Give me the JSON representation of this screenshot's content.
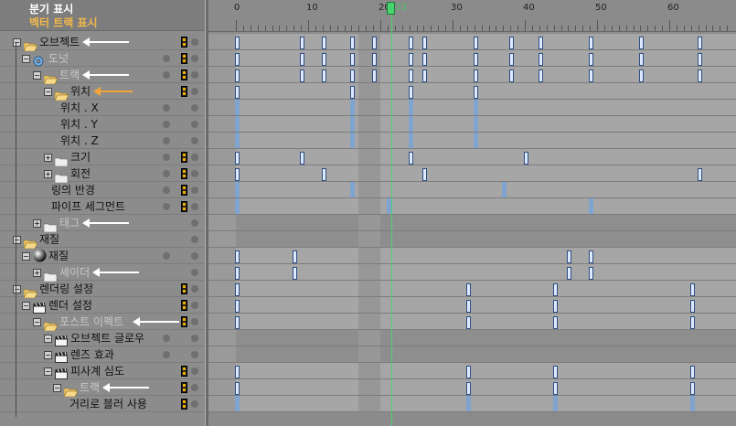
{
  "header": {
    "title": "분기 표시",
    "subtitle": "벡터 트랙 표시"
  },
  "ruler": {
    "labels": [
      "0",
      "10",
      "20",
      "30",
      "40",
      "50",
      "60"
    ],
    "current_frame": "22"
  },
  "tree": [
    {
      "label": "오브젝트",
      "level": 0,
      "icon": "folder-open-icon",
      "arrow": "white"
    },
    {
      "label": "도넛",
      "level": 1,
      "icon": "donut-icon",
      "dim": true
    },
    {
      "label": "트랙",
      "level": 2,
      "icon": "folder-open-icon",
      "dim": true,
      "arrow": "white"
    },
    {
      "label": "위치",
      "level": 3,
      "icon": "folder-open-icon",
      "arrow": "orange"
    },
    {
      "label": "위치 . X",
      "level": 4,
      "icon": "none"
    },
    {
      "label": "위치 . Y",
      "level": 4,
      "icon": "none"
    },
    {
      "label": "위치 . Z",
      "level": 4,
      "icon": "none"
    },
    {
      "label": "크기",
      "level": 3,
      "icon": "folder-closed-icon"
    },
    {
      "label": "회전",
      "level": 3,
      "icon": "folder-closed-icon"
    },
    {
      "label": "링의 반경",
      "level": 3,
      "icon": "none"
    },
    {
      "label": "파이프 세그먼트",
      "level": 3,
      "icon": "none"
    },
    {
      "label": "태그",
      "level": 2,
      "icon": "folder-closed-icon",
      "dim": true,
      "arrow": "white"
    },
    {
      "label": "재질",
      "level": 0,
      "icon": "folder-open-icon"
    },
    {
      "label": "재질",
      "level": 1,
      "icon": "sphere-icon"
    },
    {
      "label": "셰이더",
      "level": 2,
      "icon": "folder-closed-icon",
      "dim": true,
      "arrow": "white"
    },
    {
      "label": "렌더링 설정",
      "level": 0,
      "icon": "folder-open-icon"
    },
    {
      "label": "렌더 설정",
      "level": 1,
      "icon": "render-settings-icon"
    },
    {
      "label": "포스트 이펙트",
      "level": 2,
      "icon": "folder-open-icon",
      "dim": true,
      "arrow": "white"
    },
    {
      "label": "오브젝트 글로우",
      "level": 3,
      "icon": "clapper-icon"
    },
    {
      "label": "렌즈 효과",
      "level": 3,
      "icon": "clapper-icon"
    },
    {
      "label": "피사계 심도",
      "level": 3,
      "icon": "clapper-icon"
    },
    {
      "label": "트랙",
      "level": 4,
      "icon": "folder-open-icon",
      "dim": true,
      "arrow": "white"
    },
    {
      "label": "거리로 블러 사용",
      "level": 5,
      "icon": "none"
    }
  ],
  "tracks": [
    {
      "keys": [
        0,
        9,
        12,
        16,
        19,
        24,
        26,
        33,
        38,
        42,
        49,
        56,
        64
      ]
    },
    {
      "keys": [
        0,
        9,
        12,
        16,
        19,
        24,
        26,
        33,
        38,
        42,
        49,
        56,
        64
      ]
    },
    {
      "keys": [
        0,
        9,
        12,
        16,
        19,
        24,
        26,
        33,
        38,
        42,
        49,
        56,
        64
      ]
    },
    {
      "keys": [
        0,
        16,
        24,
        33
      ]
    },
    {
      "keys": [],
      "marks": [
        0,
        16,
        24,
        33
      ]
    },
    {
      "keys": [],
      "marks": [
        0,
        16,
        24,
        33
      ]
    },
    {
      "keys": [],
      "marks": [
        0,
        16,
        24,
        33
      ]
    },
    {
      "keys": [
        0,
        9,
        24,
        40
      ]
    },
    {
      "keys": [
        0,
        12,
        26,
        64
      ]
    },
    {
      "keys": [],
      "marks": [
        0,
        16,
        37
      ]
    },
    {
      "keys": [],
      "marks": [
        0,
        21,
        49
      ]
    },
    {
      "keys": []
    },
    {
      "keys": []
    },
    {
      "keys": [
        0,
        8,
        46,
        49
      ]
    },
    {
      "keys": [
        0,
        8,
        46,
        49
      ]
    },
    {
      "keys": [
        0,
        32,
        44,
        63
      ]
    },
    {
      "keys": [
        0,
        32,
        44,
        63
      ]
    },
    {
      "keys": [
        0,
        32,
        44,
        63
      ]
    },
    {
      "keys": []
    },
    {
      "keys": []
    },
    {
      "keys": [
        0,
        32,
        44,
        63
      ]
    },
    {
      "keys": [
        0,
        32,
        44,
        63
      ]
    },
    {
      "keys": [],
      "marks": [
        0,
        32,
        44,
        63
      ]
    }
  ]
}
